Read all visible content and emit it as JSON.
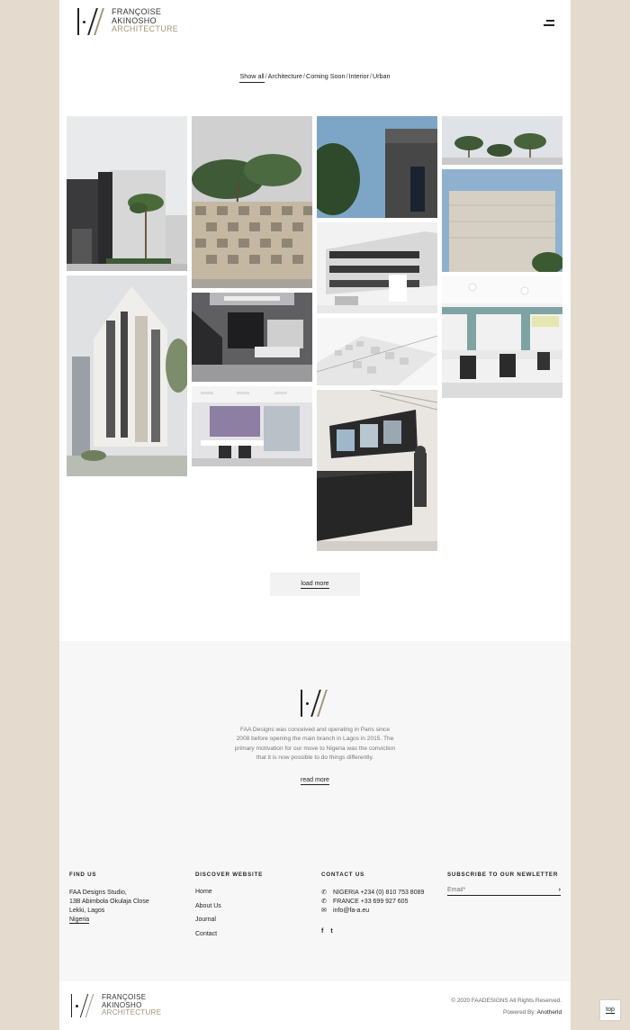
{
  "brand": {
    "line1": "FRANÇOISE",
    "line2": "AKINOSHO",
    "line3": "ARCHITECTURE",
    "accent_color": "#a29479"
  },
  "header": {
    "menu_icon": "hamburger-menu-icon"
  },
  "filters": {
    "items": [
      "Show all",
      "Architecture",
      "Coming Soon",
      "Interior",
      "Urban"
    ],
    "separator": "/",
    "active": "Show all"
  },
  "gallery": {
    "projects": [
      {
        "subject": "modern white villa with palm tree"
      },
      {
        "subject": "high-rise apartment tower"
      },
      {
        "subject": "checkered brick screen wall with palms"
      },
      {
        "subject": "dark interior staircase and lounge"
      },
      {
        "subject": "office with lilac wall"
      },
      {
        "subject": "building detail against blue sky"
      },
      {
        "subject": "terraced apartment building"
      },
      {
        "subject": "white urban massing model"
      },
      {
        "subject": "retail kiosk with screens"
      },
      {
        "subject": "palm trees against sky"
      },
      {
        "subject": "beige ribbed facade building"
      },
      {
        "subject": "open-plan office with teal columns"
      }
    ],
    "load_more_label": "load more"
  },
  "about": {
    "text": "FAA Designs was conceived and operating in Paris since 2008 before opening the main branch in Lagos in 2015. The primary motivation for our move to Nigeria was the conviction that it is now possible to do things differently.",
    "read_more_label": "read more"
  },
  "footer": {
    "find_us": {
      "title": "FIND US",
      "lines": [
        "FAA Designs Studio,",
        "13B Abimbola Okulaja Close",
        "Lekki, Lagos"
      ],
      "country": "Nigeria"
    },
    "discover": {
      "title": "DISCOVER WEBSITE",
      "links": [
        "Home",
        "About Us",
        "Journal",
        "Contact"
      ]
    },
    "contact": {
      "title": "CONTACT US",
      "nigeria": "NIGERIA +234 (0) 810 753 8089",
      "france": "FRANCE +33 699 927 605",
      "email": "info@fa-a.eu",
      "social": [
        "facebook-icon",
        "twitter-icon"
      ]
    },
    "subscribe": {
      "title": "SUBSCRIBE TO OUR NEWLETTER",
      "placeholder": "Email*",
      "send_icon": "send-icon"
    }
  },
  "bottom": {
    "copyright": "© 2020 FAADESIGNS All Rights Reserved.",
    "powered_prefix": "Powered By:",
    "powered_by": "Anotherld"
  },
  "top_button_label": "top"
}
